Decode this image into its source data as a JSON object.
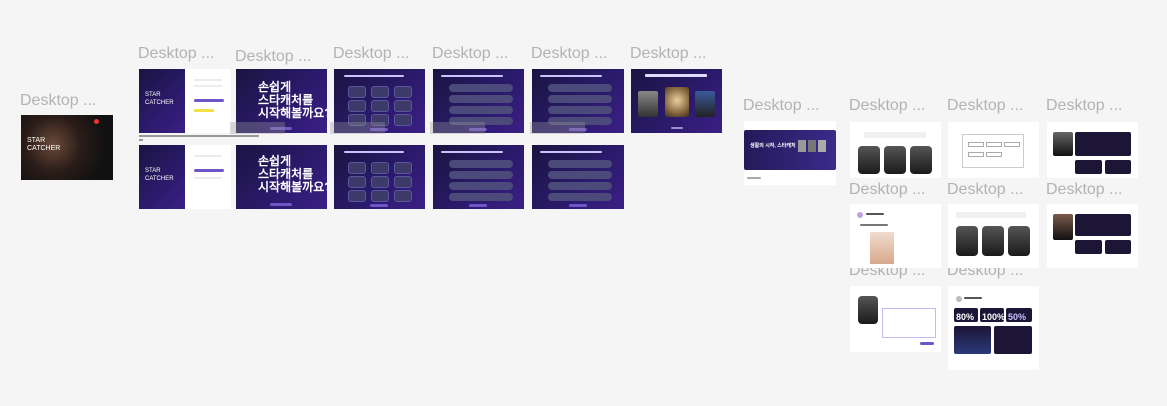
{
  "frame_label": "Desktop ...",
  "star_catcher": "STAR\nCATCHER",
  "welcome_line1": "손쉽게",
  "welcome_line2": "스타캐처를",
  "welcome_line3": "시작해볼까요?",
  "banner_title": "생활의 시작, 스타캐처",
  "stat_80": "80%",
  "stat_100": "100%",
  "stat_50": "50%",
  "colors": {
    "canvas": "#f5f5f5",
    "label": "#b3b3b3",
    "accent": "#6e56c8",
    "dark": "#2a1a6a"
  }
}
